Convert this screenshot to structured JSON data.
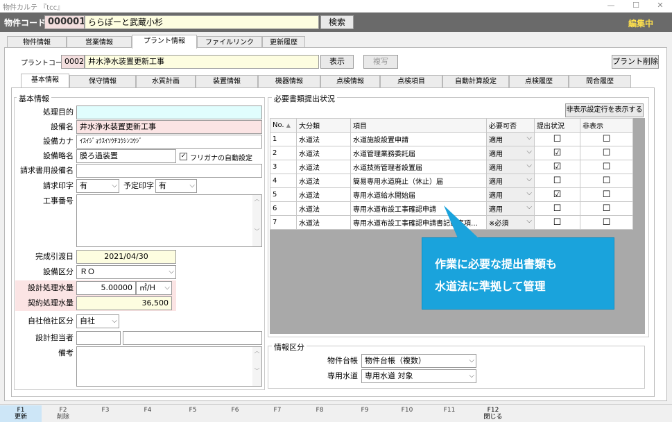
{
  "window": {
    "title": "物件カルテ 『tcc』"
  },
  "header": {
    "code_label": "物件コード",
    "code": "000001",
    "name": "ららぽーと武蔵小杉",
    "search": "検索",
    "status": "編集中"
  },
  "main_tabs": [
    "物件情報",
    "営業情報",
    "プラント情報",
    "ファイルリンク",
    "更新履歴"
  ],
  "plant": {
    "code_label": "プラントコード",
    "code": "0002",
    "name": "井水浄水装置更新工事",
    "show": "表示",
    "copy": "複写",
    "delete": "プラント削除"
  },
  "sub_tabs": [
    "基本情報",
    "保守情報",
    "水質計画",
    "装置情報",
    "機器情報",
    "点検情報",
    "点検項目",
    "自動計算設定",
    "点検履歴",
    "問合履歴"
  ],
  "basic": {
    "section": "基本情報",
    "purpose_label": "処理目的",
    "purpose": "",
    "eq_name_label": "設備名",
    "eq_name": "井水浄水装置更新工事",
    "eq_kana_label": "設備カナ",
    "eq_kana": "ｲｽｲｼﾞｮｳｽｲｿｳﾁｺｳｼﾝｺｳｼﾞ",
    "eq_short_label": "設備略名",
    "eq_short": "膜ろ過装置",
    "auto_kana": "フリガナの自動設定",
    "billing_name_label": "請求書用設備名",
    "billing_name": "",
    "billing_print_label": "請求印字",
    "billing_print": "有",
    "sched_print_label": "予定印字",
    "sched_print": "有",
    "work_no_label": "工事番号",
    "completion_label": "完成引渡日",
    "completion": "2021/04/30",
    "category_label": "設備区分",
    "category": "ＲＯ",
    "design_flow_label": "設計処理水量",
    "design_flow": "5.00000",
    "design_unit": "㎥/H",
    "contract_flow_label": "契約処理水量",
    "contract_flow": "36,500",
    "own_label": "自社他社区分",
    "own": "自社",
    "designer_label": "設計担当者",
    "remarks_label": "備考"
  },
  "docs": {
    "section": "必要書類提出状況",
    "show_hidden": "非表示設定行を表示する",
    "headers": [
      "No.",
      "大分類",
      "項目",
      "必要可否",
      "提出状況",
      "非表示"
    ],
    "rows": [
      {
        "no": "1",
        "cat": "水道法",
        "item": "水道施設設置申請",
        "need": "適用",
        "sub": "☐",
        "hide": "☐"
      },
      {
        "no": "2",
        "cat": "水道法",
        "item": "水道管理業務委託届",
        "need": "適用",
        "sub": "☑",
        "hide": "☐"
      },
      {
        "no": "3",
        "cat": "水道法",
        "item": "水道技術管理者設置届",
        "need": "適用",
        "sub": "☑",
        "hide": "☐"
      },
      {
        "no": "4",
        "cat": "水道法",
        "item": "簡易専用水道廃止（休止）届",
        "need": "適用",
        "sub": "☐",
        "hide": "☐"
      },
      {
        "no": "5",
        "cat": "水道法",
        "item": "専用水道給水開始届",
        "need": "適用",
        "sub": "☑",
        "hide": "☐"
      },
      {
        "no": "6",
        "cat": "水道法",
        "item": "専用水道布設工事確認申請",
        "need": "適用",
        "sub": "☐",
        "hide": "☐"
      },
      {
        "no": "7",
        "cat": "水道法",
        "item": "専用水道布設工事確認申請書記載事項…",
        "need": "※必須",
        "sub": "☐",
        "hide": "☐"
      }
    ]
  },
  "callout": {
    "line1": "作業に必要な提出書類も",
    "line2": "水道法に準拠して管理"
  },
  "info": {
    "section": "情報区分",
    "ledger_label": "物件台帳",
    "ledger": "物件台帳（複数）",
    "water_label": "専用水道",
    "water": "専用水道 対象"
  },
  "fkeys": [
    [
      "F1",
      "更新"
    ],
    [
      "F2",
      "削除"
    ],
    [
      "F3",
      ""
    ],
    [
      "F4",
      ""
    ],
    [
      "F5",
      ""
    ],
    [
      "F6",
      ""
    ],
    [
      "F7",
      ""
    ],
    [
      "F8",
      ""
    ],
    [
      "F9",
      ""
    ],
    [
      "F10",
      ""
    ],
    [
      "F11",
      ""
    ],
    [
      "F12",
      "閉じる"
    ]
  ],
  "colors": {
    "accent": "#1aa3dc",
    "yellow": "#fdfde0",
    "pink": "#fbe4e4",
    "topbar": "#6a6a6a"
  }
}
